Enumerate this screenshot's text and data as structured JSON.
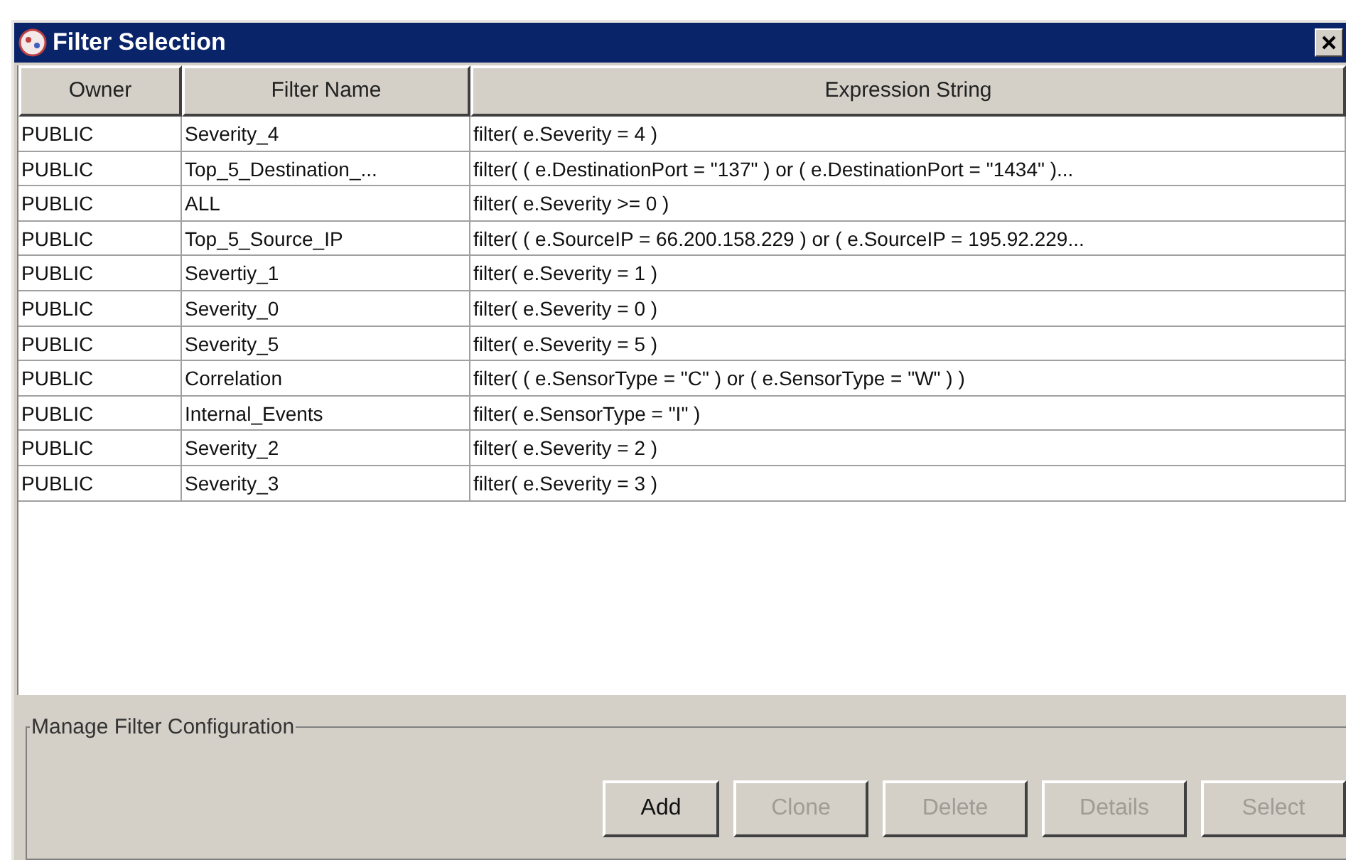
{
  "window": {
    "title": "Filter Selection"
  },
  "table": {
    "columns": [
      "Owner",
      "Filter Name",
      "Expression String"
    ],
    "rows": [
      [
        "PUBLIC",
        "Severity_4",
        "filter( e.Severity = 4 )"
      ],
      [
        "PUBLIC",
        "Top_5_Destination_...",
        "filter( ( e.DestinationPort = \"137\" )   or ( e.DestinationPort = \"1434\" )..."
      ],
      [
        "PUBLIC",
        "ALL",
        "filter( e.Severity >= 0 )"
      ],
      [
        "PUBLIC",
        "Top_5_Source_IP",
        "filter( ( e.SourceIP = 66.200.158.229 ) or ( e.SourceIP = 195.92.229..."
      ],
      [
        "PUBLIC",
        "Severtiy_1",
        "filter( e.Severity = 1 )"
      ],
      [
        "PUBLIC",
        "Severity_0",
        "filter( e.Severity = 0 )"
      ],
      [
        "PUBLIC",
        "Severity_5",
        "filter( e.Severity = 5 )"
      ],
      [
        "PUBLIC",
        "Correlation",
        "filter( ( e.SensorType = \"C\" ) or ( e.SensorType = \"W\" ) )"
      ],
      [
        "PUBLIC",
        "Internal_Events",
        "filter( e.SensorType = \"I\" )"
      ],
      [
        "PUBLIC",
        "Severity_2",
        "filter( e.Severity = 2 )"
      ],
      [
        "PUBLIC",
        "Severity_3",
        "filter( e.Severity = 3 )"
      ]
    ]
  },
  "group": {
    "title": "Manage Filter Configuration",
    "buttons": [
      {
        "label": "Add",
        "disabled": false
      },
      {
        "label": "Clone",
        "disabled": true
      },
      {
        "label": "Delete",
        "disabled": true
      },
      {
        "label": "Details",
        "disabled": true
      },
      {
        "label": "Select",
        "disabled": true
      }
    ]
  }
}
